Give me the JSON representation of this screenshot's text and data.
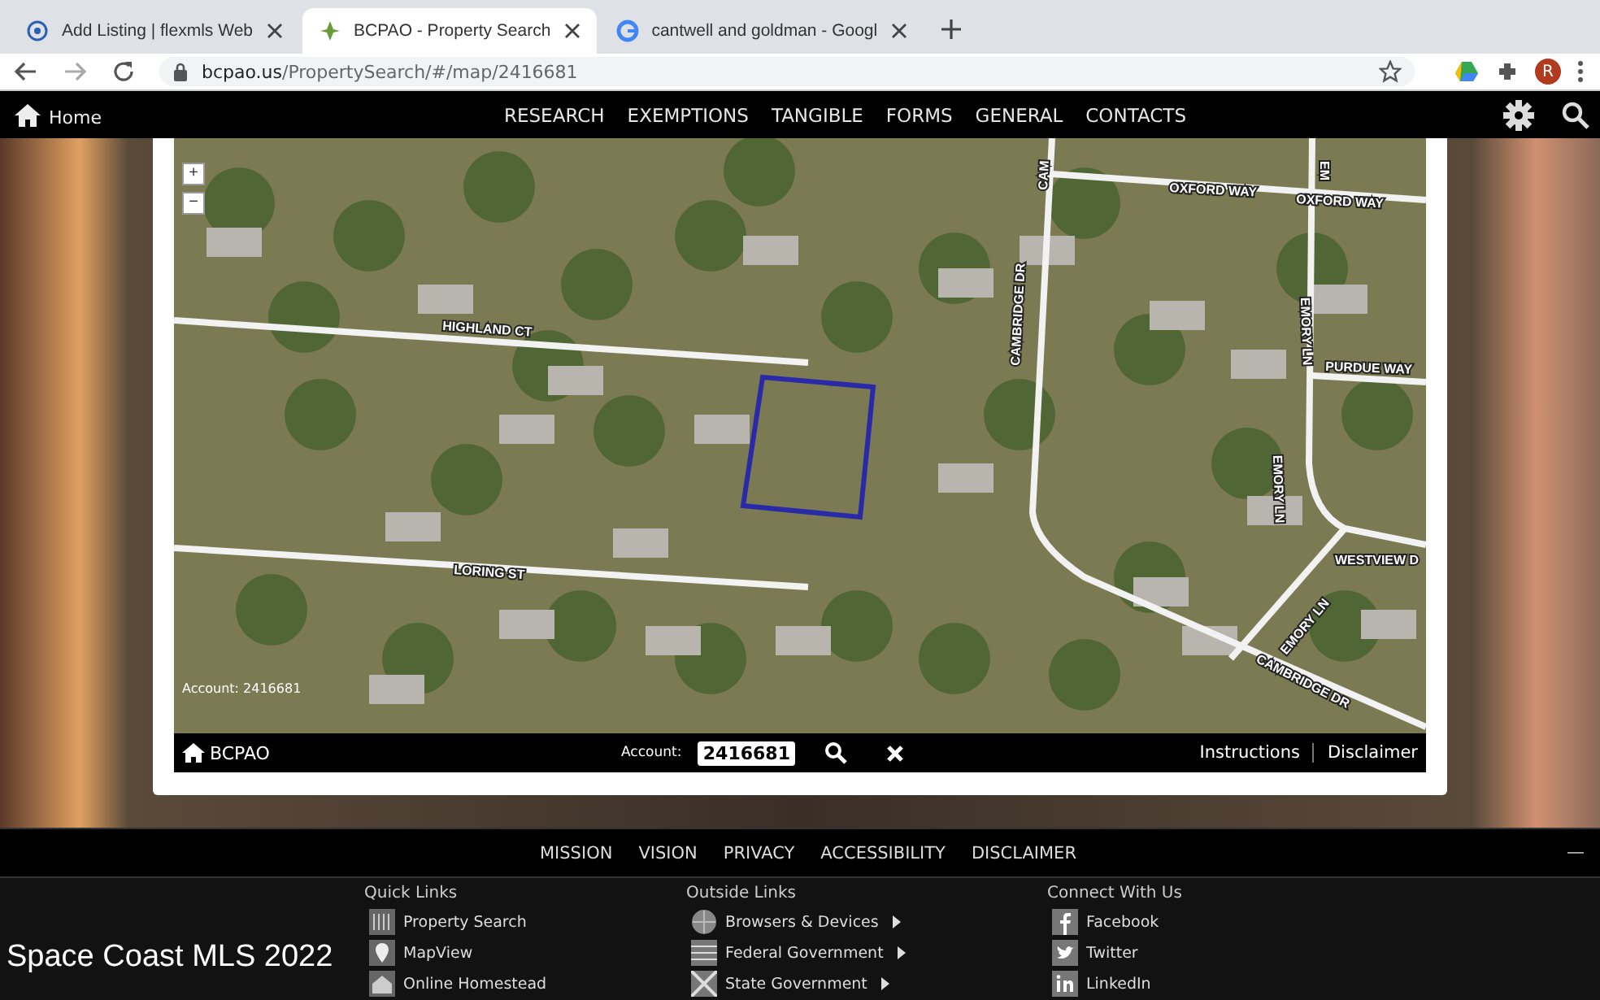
{
  "browser": {
    "tabs": [
      {
        "title": "Add Listing | flexmls Web",
        "selected": false
      },
      {
        "title": "BCPAO - Property Search",
        "selected": true
      },
      {
        "title": "cantwell and goldman - Googl",
        "selected": false
      }
    ],
    "url_host": "bcpao.us",
    "url_path": "/PropertySearch/#/map/2416681",
    "profile_initial": "R"
  },
  "nav": {
    "home": "Home",
    "items": [
      "RESEARCH",
      "EXEMPTIONS",
      "TANGIBLE",
      "FORMS",
      "GENERAL",
      "CONTACTS"
    ]
  },
  "map": {
    "zoom_in": "+",
    "zoom_out": "−",
    "streets": [
      "HIGHLAND CT",
      "LORING ST",
      "CAMBRIDGE DR",
      "OXFORD WAY",
      "OXFORD WAY",
      "PURDUE WAY",
      "EMORY LN",
      "EMORY LN",
      "EMORY LN",
      "WESTVIEW D",
      "CAMBRIDGE DR",
      "CAM",
      "EM"
    ],
    "account_overlay": "Account: 2416681"
  },
  "map_bar": {
    "logo": "BCPAO",
    "account_label": "Account:",
    "account_value": "2416681",
    "links": [
      "Instructions",
      "Disclaimer"
    ]
  },
  "footer": {
    "nav": [
      "MISSION",
      "VISION",
      "PRIVACY",
      "ACCESSIBILITY",
      "DISCLAIMER"
    ],
    "collapse": "—",
    "brand": "Space Coast MLS 2022",
    "columns": [
      {
        "title": "Quick Links",
        "links": [
          {
            "label": "Property Search",
            "submenu": false
          },
          {
            "label": "MapView",
            "submenu": false
          },
          {
            "label": "Online Homestead",
            "submenu": false
          }
        ]
      },
      {
        "title": "Outside Links",
        "links": [
          {
            "label": "Browsers & Devices",
            "submenu": true
          },
          {
            "label": "Federal Government",
            "submenu": true
          },
          {
            "label": "State Government",
            "submenu": true
          }
        ]
      },
      {
        "title": "Connect With Us",
        "links": [
          {
            "label": "Facebook",
            "submenu": false
          },
          {
            "label": "Twitter",
            "submenu": false
          },
          {
            "label": "LinkedIn",
            "submenu": false
          }
        ]
      }
    ]
  }
}
